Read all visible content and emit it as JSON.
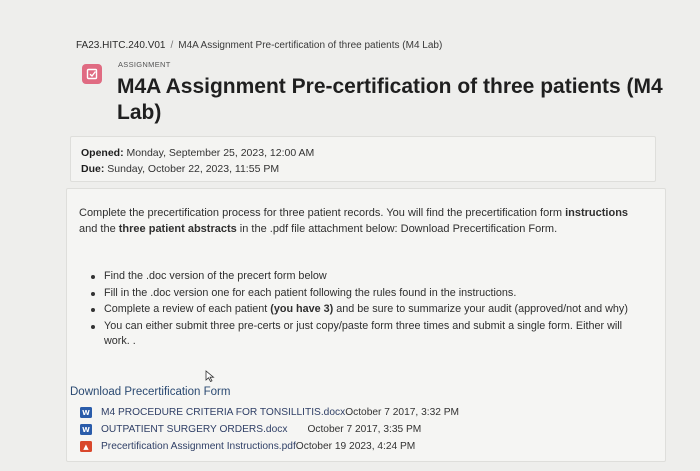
{
  "breadcrumb": {
    "course": "FA23.HITC.240.V01",
    "separator": "/",
    "current": "M4A Assignment Pre-certification of three patients (M4 Lab)"
  },
  "header": {
    "kind": "ASSIGNMENT",
    "title": "M4A Assignment Pre-certification of three patients (M4 Lab)",
    "icon": "assignment-icon",
    "icon_color": "#e06b82"
  },
  "dates": {
    "opened_label": "Opened:",
    "opened_value": "Monday, September 25, 2023, 12:00 AM",
    "due_label": "Due:",
    "due_value": "Sunday, October 22, 2023, 11:55 PM"
  },
  "description": {
    "intro_1": "Complete the precertification process for three patient records. You will find the precertification form",
    "intro_bold_1": "instructions",
    "intro_2": " and the ",
    "intro_bold_2": "three patient abstracts",
    "intro_3": " in the .pdf file attachment below: Download Precertification Form.",
    "bullets": [
      {
        "text": "Find the .doc version of the precert form below"
      },
      {
        "text": "Fill in the .doc version one for each patient following the rules found in the instructions."
      },
      {
        "pre": "Complete a review of each patient ",
        "bold": "(you have 3)",
        "post": " and be sure to summarize your audit (approved/not and why)"
      },
      {
        "text": "You can either submit three pre-certs or just copy/paste form three times and submit a single form. Either will work. ."
      }
    ]
  },
  "attachments": {
    "heading": "Download Precertification Form",
    "files": [
      {
        "type": "word",
        "name": "M4 PROCEDURE CRITERIA FOR TONSILLITIS.docx",
        "date": "October 7 2017, 3:32 PM"
      },
      {
        "type": "word",
        "name": "OUTPATIENT SURGERY ORDERS.docx",
        "date": "October 7 2017, 3:35 PM"
      },
      {
        "type": "pdf",
        "name": "Precertification Assignment Instructions.pdf",
        "date": "October 19 2023, 4:24 PM"
      }
    ]
  },
  "colors": {
    "link": "#2b4a72",
    "word": "#2a5caa",
    "pdf": "#d9482c"
  }
}
